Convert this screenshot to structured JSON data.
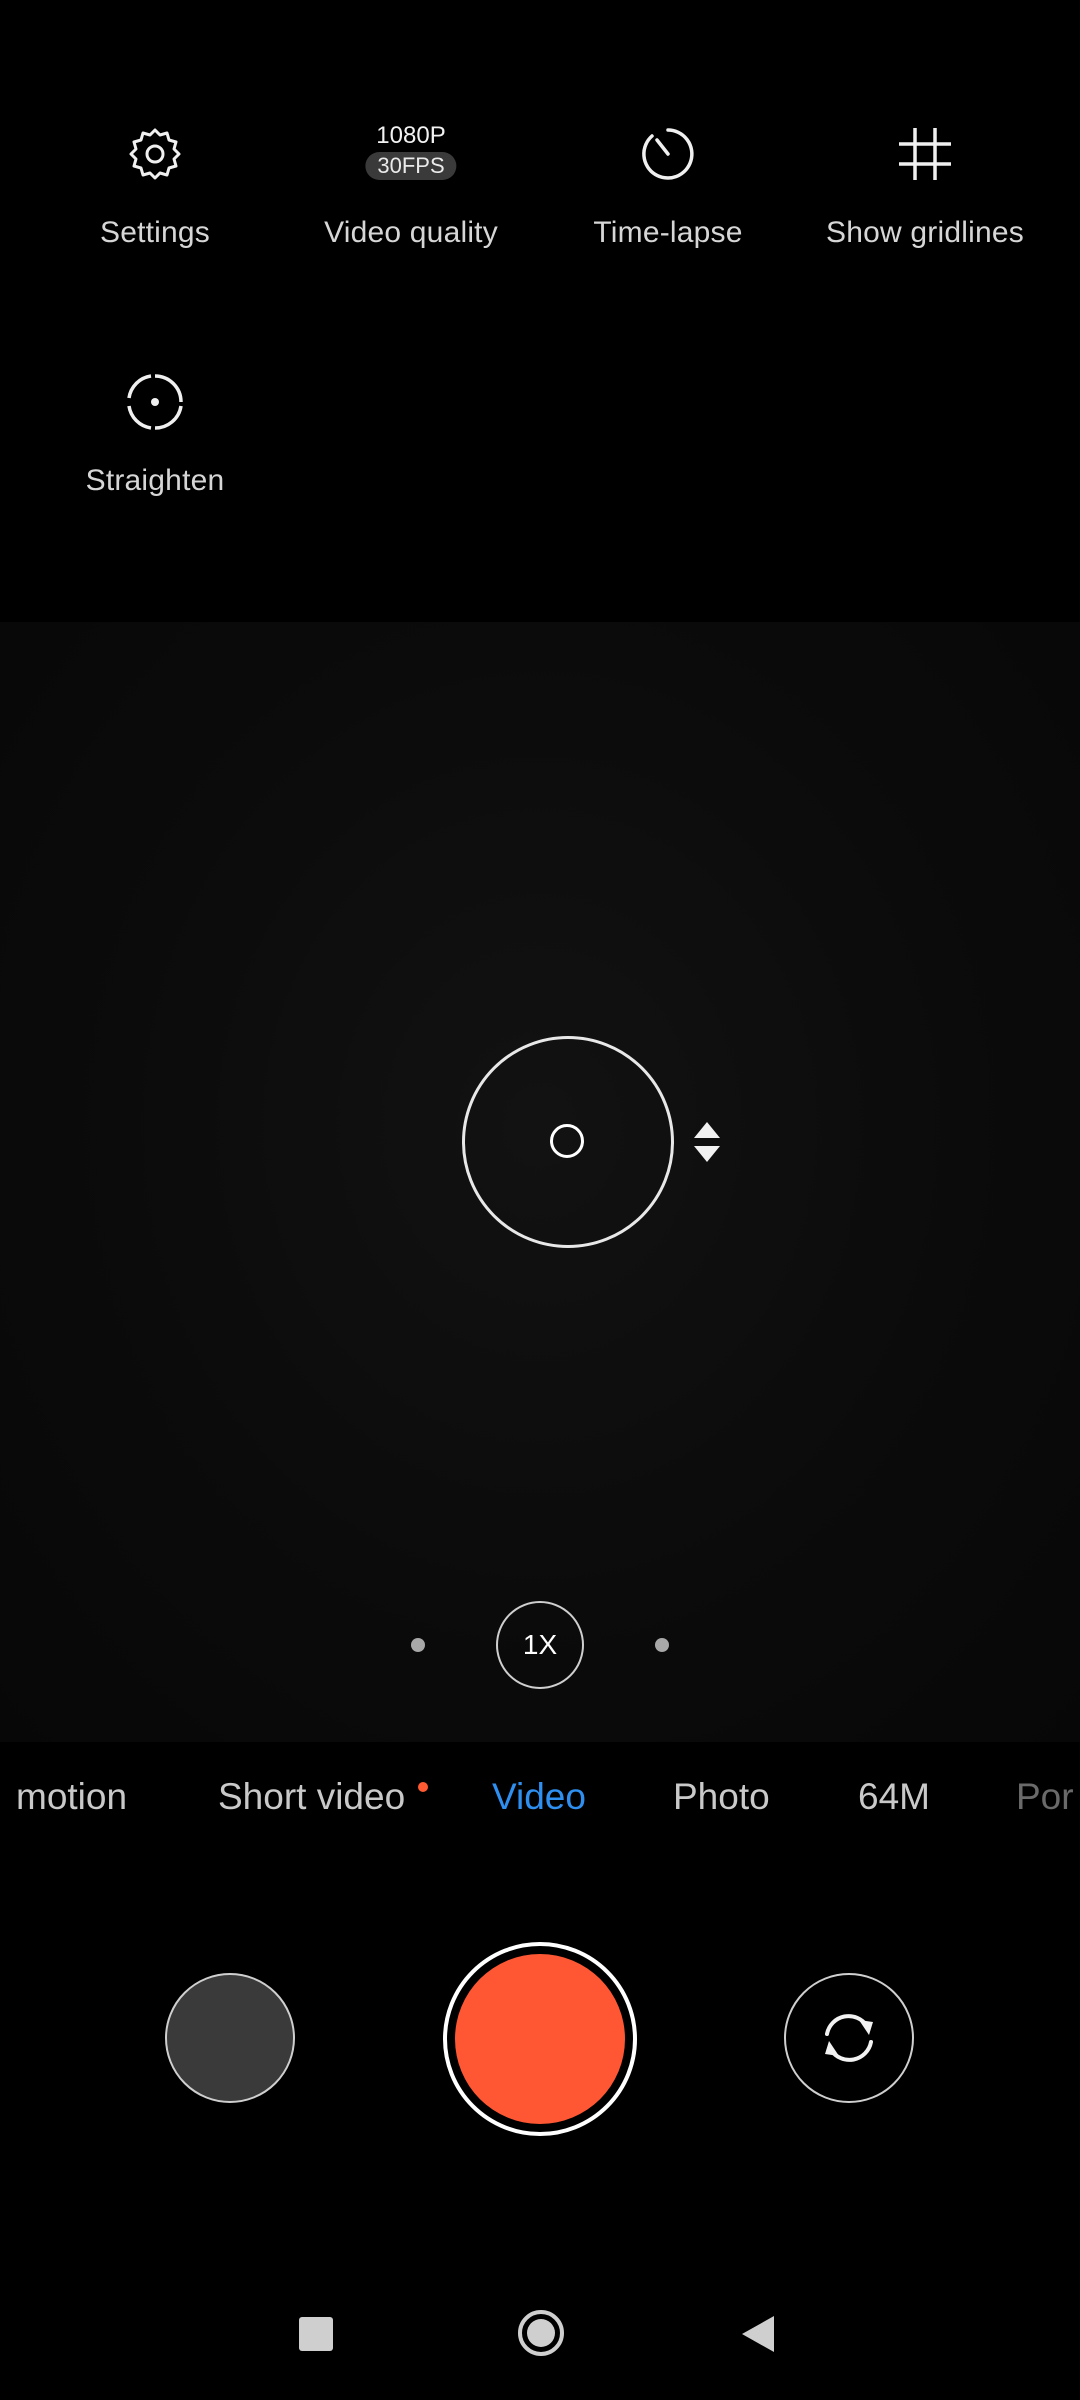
{
  "quick_settings": {
    "settings": {
      "label": "Settings",
      "icon": "gear-icon"
    },
    "video_quality": {
      "label": "Video quality",
      "resolution": "1080P",
      "fps": "30FPS"
    },
    "time_lapse": {
      "label": "Time-lapse",
      "icon": "timer-icon"
    },
    "gridlines": {
      "label": "Show gridlines",
      "icon": "grid-icon"
    },
    "straighten": {
      "label": "Straighten",
      "icon": "level-icon"
    }
  },
  "zoom": {
    "level": "1X"
  },
  "modes": [
    {
      "label": "motion"
    },
    {
      "label": "Short video"
    },
    {
      "label": "Video",
      "active": true
    },
    {
      "label": "Photo"
    },
    {
      "label": "64M"
    },
    {
      "label": "Por"
    }
  ],
  "colors": {
    "accent": "#2e8ff0",
    "shutter": "#ff5733",
    "badge_dot": "#ff5a32"
  }
}
